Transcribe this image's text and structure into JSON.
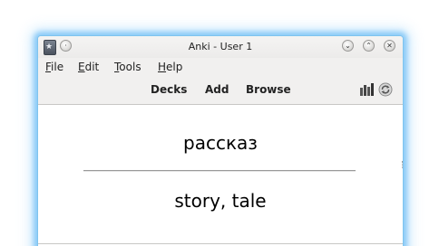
{
  "window": {
    "title": "Anki - User 1"
  },
  "titlebar_buttons": {
    "menu_icon": "anki-star-icon",
    "sticky_icon": "circle-icon",
    "minimize_icon": "chevron-down-icon",
    "maximize_icon": "chevron-up-icon",
    "close_icon": "close-icon",
    "minimize_glyph": "⌄",
    "maximize_glyph": "⌃",
    "close_glyph": "✕"
  },
  "menubar": {
    "items": [
      {
        "underline": "F",
        "rest": "ile"
      },
      {
        "underline": "E",
        "rest": "dit"
      },
      {
        "underline": "T",
        "rest": "ools"
      },
      {
        "underline": "H",
        "rest": "elp"
      }
    ]
  },
  "toolbar": {
    "decks": "Decks",
    "add": "Add",
    "browse": "Browse",
    "stats_icon": "bar-chart-icon",
    "sync_icon": "sync-icon"
  },
  "card": {
    "front": "рассказ",
    "back": "story, tale"
  },
  "colors": {
    "window_glow": "#70bef5",
    "window_bg": "#f1f0ef",
    "card_bg": "#ffffff"
  }
}
